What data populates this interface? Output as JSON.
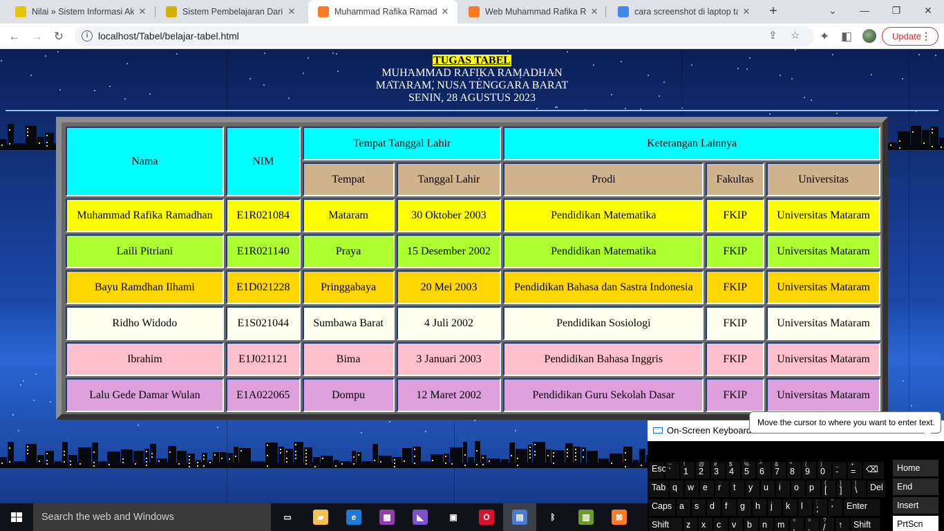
{
  "browser": {
    "tabs": [
      {
        "title": "Nilai » Sistem Informasi Akad",
        "favicon": "university-logo-icon",
        "fav_color": "#e8c400",
        "active": false
      },
      {
        "title": "Sistem Pembelajaran Daring",
        "favicon": "university-logo-icon",
        "fav_color": "#d4b000",
        "active": false
      },
      {
        "title": "Muhammad Rafika Ramadha",
        "favicon": "xampp-icon",
        "fav_color": "#fb7a24",
        "active": true
      },
      {
        "title": "Web Muhammad Rafika Ram",
        "favicon": "xampp-icon",
        "fav_color": "#fb7a24",
        "active": false
      },
      {
        "title": "cara screenshot di laptop tan",
        "favicon": "google-icon",
        "fav_color": "#4285f4",
        "active": false
      }
    ],
    "close_glyph": "✕",
    "new_tab_glyph": "+",
    "url": "localhost/Tabel/belajar-tabel.html",
    "update_label": "Update"
  },
  "page": {
    "header": {
      "line1": "TUGAS TABEL",
      "line2": "MUHAMMAD RAFIKA RAMADHAN",
      "line3": "MATARAM, NUSA TENGGARA BARAT",
      "line4": "SENIN, 28 AGUSTUS 2023"
    },
    "table": {
      "group_headers": {
        "nama": "Nama",
        "nim": "NIM",
        "ttl": "Tempat Tanggal Lahir",
        "lainnya": "Keterangan Lainnya"
      },
      "sub_headers": [
        "Tempat",
        "Tanggal Lahir",
        "Prodi",
        "Fakultas",
        "Universitas"
      ],
      "header_colors": {
        "top": "#00ffff",
        "sub": "#d2b48c"
      },
      "rows": [
        {
          "color": "#ffff00",
          "cells": [
            "Muhammad Rafika Ramadhan",
            "E1R021084",
            "Mataram",
            "30 Oktober 2003",
            "Pendidikan Matematika",
            "FKIP",
            "Universitas Mataram"
          ]
        },
        {
          "color": "#adff2f",
          "cells": [
            "Laili Pitriani",
            "E1R021140",
            "Praya",
            "15 Desember 2002",
            "Pendidikan Matematika",
            "FKIP",
            "Universitas Mataram"
          ]
        },
        {
          "color": "#ffd700",
          "cells": [
            "Bayu Ramdhan Ilhami",
            "E1D021228",
            "Pringgabaya",
            "20 Mei 2003",
            "Pendidikan Bahasa dan Sastra Indonesia",
            "FKIP",
            "Universitas Mataram"
          ]
        },
        {
          "color": "#fffff0",
          "cells": [
            "Ridho Widodo",
            "E1S021044",
            "Sumbawa Barat",
            "4 Juli 2002",
            "Pendidikan Sosiologi",
            "FKIP",
            "Universitas Mataram"
          ]
        },
        {
          "color": "#ffc0cb",
          "cells": [
            "Ibrahim",
            "E1J021121",
            "Bima",
            "3 Januari 2003",
            "Pendidikan Bahasa Inggris",
            "FKIP",
            "Universitas Mataram"
          ]
        },
        {
          "color": "#dda0dd",
          "cells": [
            "Lalu Gede Damar Wulan",
            "E1A022065",
            "Dompu",
            "12 Maret 2002",
            "Pendidikan Guru Sekolah Dasar",
            "FKIP",
            "Universitas Mataram"
          ]
        }
      ]
    }
  },
  "osk": {
    "title": "On-Screen Keyboard",
    "tooltip": "Move the cursor to where you want to enter text.",
    "rows": [
      [
        {
          "m": "Esc",
          "w": 22
        },
        {
          "m": "`",
          "s": "~",
          "w": 20
        },
        {
          "m": "1",
          "s": "!",
          "w": 20
        },
        {
          "m": "2",
          "s": "@",
          "w": 20
        },
        {
          "m": "3",
          "s": "#",
          "w": 20
        },
        {
          "m": "4",
          "s": "$",
          "w": 20
        },
        {
          "m": "5",
          "s": "%",
          "w": 20
        },
        {
          "m": "6",
          "s": "^",
          "w": 20
        },
        {
          "m": "7",
          "s": "&",
          "w": 20
        },
        {
          "m": "8",
          "s": "*",
          "w": 20
        },
        {
          "m": "9",
          "s": "(",
          "w": 20
        },
        {
          "m": "0",
          "s": ")",
          "w": 20
        },
        {
          "m": "-",
          "s": "_",
          "w": 20
        },
        {
          "m": "=",
          "s": "+",
          "w": 20
        },
        {
          "m": "⌫",
          "w": 30
        }
      ],
      [
        {
          "m": "Tab",
          "w": 28
        },
        {
          "m": "q",
          "w": 20
        },
        {
          "m": "w",
          "w": 20
        },
        {
          "m": "e",
          "w": 20
        },
        {
          "m": "r",
          "w": 20
        },
        {
          "m": "t",
          "w": 20
        },
        {
          "m": "y",
          "w": 20
        },
        {
          "m": "u",
          "w": 20
        },
        {
          "m": "i",
          "w": 20
        },
        {
          "m": "o",
          "w": 20
        },
        {
          "m": "p",
          "w": 20
        },
        {
          "m": "[",
          "s": "{",
          "w": 20
        },
        {
          "m": "]",
          "s": "}",
          "w": 20
        },
        {
          "m": "\\",
          "s": "|",
          "w": 20
        },
        {
          "m": "Del",
          "w": 26
        }
      ],
      [
        {
          "m": "Caps",
          "w": 38
        },
        {
          "m": "a",
          "w": 20
        },
        {
          "m": "s",
          "w": 20
        },
        {
          "m": "d",
          "w": 20
        },
        {
          "m": "f",
          "w": 20
        },
        {
          "m": "g",
          "w": 20
        },
        {
          "m": "h",
          "w": 20
        },
        {
          "m": "j",
          "w": 20
        },
        {
          "m": "k",
          "w": 20
        },
        {
          "m": "l",
          "w": 20
        },
        {
          "m": ";",
          "s": ":",
          "w": 20
        },
        {
          "m": "'",
          "s": "\"",
          "w": 20
        },
        {
          "m": "Enter",
          "w": 52
        }
      ],
      [
        {
          "m": "Shift",
          "w": 48
        },
        {
          "m": "z",
          "w": 20
        },
        {
          "m": "x",
          "w": 20
        },
        {
          "m": "c",
          "w": 20
        },
        {
          "m": "v",
          "w": 20
        },
        {
          "m": "b",
          "w": 20
        },
        {
          "m": "n",
          "w": 20
        },
        {
          "m": "m",
          "w": 20
        },
        {
          "m": ",",
          "s": "<",
          "w": 20
        },
        {
          "m": ".",
          "s": ">",
          "w": 20
        },
        {
          "m": "/",
          "s": "?",
          "w": 20
        },
        {
          "m": "↑",
          "w": 20
        },
        {
          "m": "Shift",
          "w": 42
        }
      ]
    ],
    "nav_keys": [
      "Home",
      "End",
      "Insert",
      "PrtScn"
    ]
  },
  "taskbar": {
    "search_placeholder": "Search the web and Windows",
    "apps": [
      {
        "name": "task-view-icon",
        "color": "#101217",
        "label": "▭",
        "active": false
      },
      {
        "name": "file-explorer-icon",
        "color": "#f2c14e",
        "label": "▰",
        "active": false
      },
      {
        "name": "edge-icon",
        "color": "#1e78d4",
        "label": "e",
        "active": false
      },
      {
        "name": "winrar-icon",
        "color": "#8e3fa8",
        "label": "▦",
        "active": false
      },
      {
        "name": "visual-studio-icon",
        "color": "#7b52c7",
        "label": "◣",
        "active": false
      },
      {
        "name": "store-icon",
        "color": "#101217",
        "label": "▣",
        "active": false
      },
      {
        "name": "opera-icon",
        "color": "#d8112c",
        "label": "O",
        "active": false
      },
      {
        "name": "control-panel-icon",
        "color": "#4a7bd0",
        "label": "▤",
        "active": true
      },
      {
        "name": "bluetooth-icon",
        "color": "#101217",
        "label": "ᛒ",
        "active": false
      },
      {
        "name": "office-icon",
        "color": "#6a9a2a",
        "label": "▥",
        "active": false
      },
      {
        "name": "xampp-icon",
        "color": "#fb7a24",
        "label": "⊠",
        "active": false
      }
    ]
  }
}
